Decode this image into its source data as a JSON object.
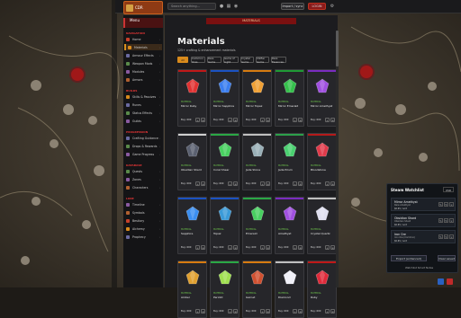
{
  "topbar": {
    "logo": "CDR",
    "search_placeholder": "Search anything...",
    "btn_import": "Import / sync",
    "btn_login": "LOGIN"
  },
  "sidebar": {
    "header": "Menu",
    "sections": [
      {
        "label": "NAVIGATION",
        "items": [
          "Home",
          "Materials",
          "Armour Effects",
          "Weapon Mods",
          "Modules",
          "Armors"
        ]
      },
      {
        "label": "BUILDS",
        "items": [
          "Skills & Passives",
          "Runes",
          "Status Effects",
          "Guilds"
        ]
      },
      {
        "label": "PROGRESSION",
        "items": [
          "Crafting Guidance",
          "Drops & Rewards",
          "Game Progress"
        ]
      },
      {
        "label": "DATABASE",
        "items": [
          "Quests",
          "Zones",
          "Characters"
        ]
      },
      {
        "label": "LORE",
        "items": [
          "Timeline",
          "Symbols",
          "Bestiary",
          "Alchemy",
          "Prophecy"
        ]
      }
    ],
    "active": "Materials"
  },
  "main": {
    "banner": "MATERIALS",
    "title": "Materials",
    "subtitle": "125+ crafting & enhancement materials",
    "tabs": [
      "All",
      "Common Ores",
      "Rare Gems",
      "Gems of Light",
      "Crystal Gems",
      "Shifter Gems",
      "Rare Essences"
    ],
    "cards": [
      {
        "cat": "MATERIAL",
        "name": "Mirror Ruby",
        "price": "Buy: 600",
        "color": "#c01818",
        "gem": "#e13232"
      },
      {
        "cat": "MATERIAL",
        "name": "Mirror Sapphire",
        "price": "Buy: 600",
        "color": "#1b52c2",
        "gem": "#3b7ef0"
      },
      {
        "cat": "MATERIAL",
        "name": "Mirror Topaz",
        "price": "Buy: 600",
        "color": "#d77b10",
        "gem": "#f0a035"
      },
      {
        "cat": "MATERIAL",
        "name": "Mirror Emerald",
        "price": "Buy: 600",
        "color": "#1f9a35",
        "gem": "#35c04c"
      },
      {
        "cat": "MATERIAL",
        "name": "Mirror Amethyst",
        "price": "Buy: 600",
        "color": "#7a2cc0",
        "gem": "#a050e0"
      },
      {
        "cat": "MATERIAL",
        "name": "Obsidian Shard",
        "price": "Buy: 600",
        "color": "#cfcfcf",
        "gem": "#5a6070"
      },
      {
        "cat": "MATERIAL",
        "name": "Coral Shear",
        "price": "Buy: 600",
        "color": "#2aa845",
        "gem": "#48d060"
      },
      {
        "cat": "MATERIAL",
        "name": "Jade Stone",
        "price": "Buy: 600",
        "color": "#bfbfbf",
        "gem": "#9ab0b8"
      },
      {
        "cat": "MATERIAL",
        "name": "Jade Prism",
        "price": "Buy: 600",
        "color": "#2ca04a",
        "gem": "#4ad070"
      },
      {
        "cat": "MATERIAL",
        "name": "Bloodstone",
        "price": "Buy: 600",
        "color": "#b51a1a",
        "gem": "#e03a4a"
      },
      {
        "cat": "MATERIAL",
        "name": "Sapphire",
        "price": "Buy: 600",
        "color": "#1b52c2",
        "gem": "#3b8ef0"
      },
      {
        "cat": "MATERIAL",
        "name": "Topaz",
        "price": "Buy: 600",
        "color": "#1b52c2",
        "gem": "#3a9ad8"
      },
      {
        "cat": "MATERIAL",
        "name": "Emerald",
        "price": "Buy: 600",
        "color": "#2aa845",
        "gem": "#48d060"
      },
      {
        "cat": "MATERIAL",
        "name": "Amethyst",
        "price": "Buy: 600",
        "color": "#7a2cc0",
        "gem": "#a050e0"
      },
      {
        "cat": "MATERIAL",
        "name": "Crystal Quartz",
        "price": "Buy: 600",
        "color": "#bfbfbf",
        "gem": "#e0e0f0"
      },
      {
        "cat": "MATERIAL",
        "name": "Amber",
        "price": "Buy: 600",
        "color": "#d77b10",
        "gem": "#e0a030"
      },
      {
        "cat": "MATERIAL",
        "name": "Peridot",
        "price": "Buy: 600",
        "color": "#2aa845",
        "gem": "#a0e050"
      },
      {
        "cat": "MATERIAL",
        "name": "Garnet",
        "price": "Buy: 600",
        "color": "#d77b10",
        "gem": "#d05030"
      },
      {
        "cat": "MATERIAL",
        "name": "Diamond",
        "price": "Buy: 600",
        "color": "#bfbfbf",
        "gem": "#f0f0f8"
      },
      {
        "cat": "MATERIAL",
        "name": "Ruby",
        "price": "Buy: 600",
        "color": "#c01818",
        "gem": "#e02a3a"
      }
    ]
  },
  "watchlist": {
    "title": "Steam Watchlist",
    "select": "USD",
    "items": [
      {
        "name": "Mirror Amethyst",
        "cat": "Rare Amethyst",
        "price": "$0.65 / unit"
      },
      {
        "name": "Obsidian Shard",
        "cat": "Obsidian Shard",
        "price": "$0.65 / unit"
      },
      {
        "name": "Iron Ore",
        "cat": "Iron Ore (Common)",
        "price": "$0.65 / unit"
      }
    ],
    "btn_left": "Export (enhanced)",
    "btn_right": "Clear saved",
    "footer": "Watchlist Smart Notes"
  }
}
